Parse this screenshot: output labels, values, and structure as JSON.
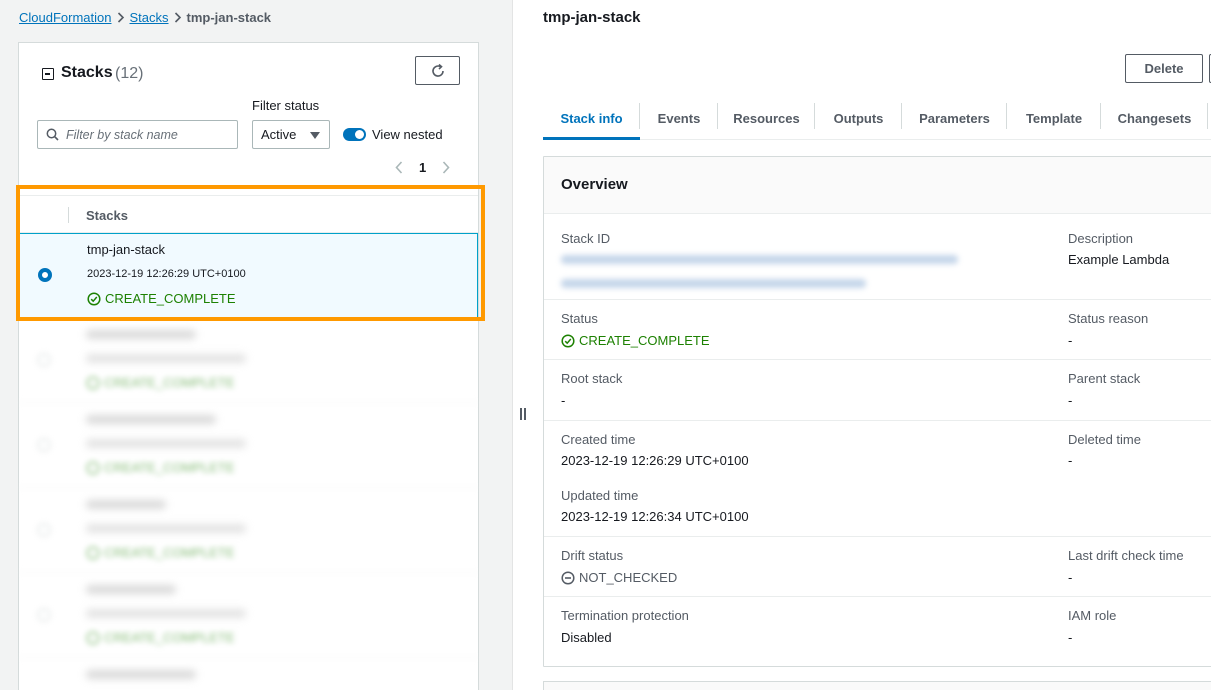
{
  "breadcrumb": {
    "root": "CloudFormation",
    "stacks": "Stacks",
    "current": "tmp-jan-stack"
  },
  "panel": {
    "title": "Stacks",
    "count": "(12)",
    "filter_status_label": "Filter status",
    "search_placeholder": "Filter by stack name",
    "status_value": "Active",
    "view_nested_label": "View nested",
    "view_nested_on": true,
    "page": "1",
    "column_stacks": "Stacks"
  },
  "stacks": [
    {
      "name": "tmp-jan-stack",
      "created": "2023-12-19 12:26:29 UTC+0100",
      "status": "CREATE_COMPLETE",
      "selected": true
    },
    {
      "status": "CREATE_COMPLETE"
    },
    {
      "status": "CREATE_COMPLETE"
    },
    {
      "status": "CREATE_COMPLETE"
    },
    {
      "status": "CREATE_COMPLETE"
    }
  ],
  "detail": {
    "title": "tmp-jan-stack",
    "delete_label": "Delete",
    "tabs": [
      "Stack info",
      "Events",
      "Resources",
      "Outputs",
      "Parameters",
      "Template",
      "Changesets"
    ],
    "active_tab": "Stack info",
    "overview_title": "Overview",
    "fields": {
      "stack_id_label": "Stack ID",
      "description_label": "Description",
      "description_value": "Example Lambda",
      "status_label": "Status",
      "status_value": "CREATE_COMPLETE",
      "status_reason_label": "Status reason",
      "status_reason_value": "-",
      "root_stack_label": "Root stack",
      "root_stack_value": "-",
      "parent_stack_label": "Parent stack",
      "parent_stack_value": "-",
      "created_time_label": "Created time",
      "created_time_value": "2023-12-19 12:26:29 UTC+0100",
      "deleted_time_label": "Deleted time",
      "deleted_time_value": "-",
      "updated_time_label": "Updated time",
      "updated_time_value": "2023-12-19 12:26:34 UTC+0100",
      "drift_status_label": "Drift status",
      "drift_status_value": "NOT_CHECKED",
      "last_drift_label": "Last drift check time",
      "last_drift_value": "-",
      "termination_label": "Termination protection",
      "termination_value": "Disabled",
      "iam_role_label": "IAM role",
      "iam_role_value": "-"
    }
  },
  "colors": {
    "accent": "#0073bb",
    "success": "#1d8102",
    "highlight": "#ff9900"
  },
  "icons": [
    "refresh-icon",
    "search-icon",
    "collapse-icon",
    "chevron-right-icon",
    "chevron-left-icon",
    "success-icon",
    "not-checked-icon"
  ]
}
